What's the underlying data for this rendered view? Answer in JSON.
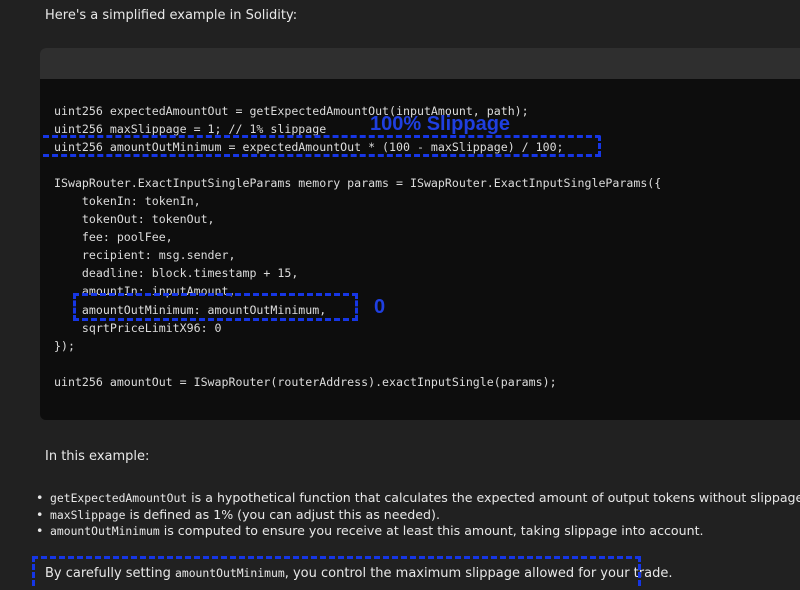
{
  "intro": "Here's a simplified example in Solidity:",
  "code_lines": [
    "uint256 expectedAmountOut = getExpectedAmountOut(inputAmount, path);",
    "uint256 maxSlippage = 1; // 1% slippage",
    "uint256 amountOutMinimum = expectedAmountOut * (100 - maxSlippage) / 100;",
    "",
    "ISwapRouter.ExactInputSingleParams memory params = ISwapRouter.ExactInputSingleParams({",
    "    tokenIn: tokenIn,",
    "    tokenOut: tokenOut,",
    "    fee: poolFee,",
    "    recipient: msg.sender,",
    "    deadline: block.timestamp + 15,",
    "    amountIn: inputAmount,",
    "    amountOutMinimum: amountOutMinimum,",
    "    sqrtPriceLimitX96: 0",
    "});",
    "",
    "uint256 amountOut = ISwapRouter(routerAddress).exactInputSingle(params);"
  ],
  "annotations": {
    "slippage_label": "100% Slippage",
    "zero_label": "0",
    "color": "#1636e5"
  },
  "explanation_heading": "In this example:",
  "bullets": [
    {
      "code": "getExpectedAmountOut",
      "text": " is a hypothetical function that calculates the expected amount of output tokens without slippage."
    },
    {
      "code": "maxSlippage",
      "text": " is defined as 1% (you can adjust this as needed)."
    },
    {
      "code": "amountOutMinimum",
      "text": " is computed to ensure you receive at least this amount, taking slippage into account."
    }
  ],
  "conclusion": {
    "before": "By carefully setting ",
    "code": "amountOutMinimum",
    "after": ", you control the maximum slippage allowed for your trade."
  }
}
